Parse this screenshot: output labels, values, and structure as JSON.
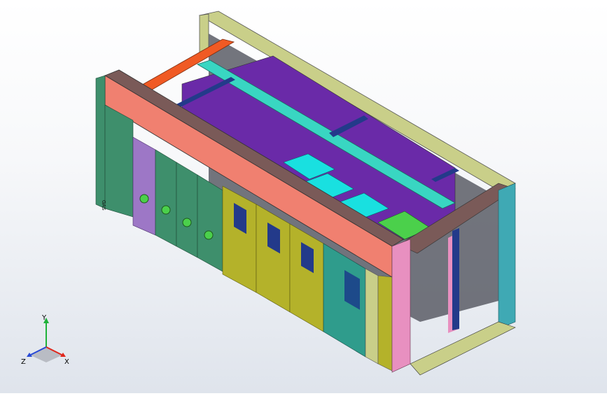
{
  "viewport": {
    "background_top": "#ffffff",
    "background_bottom": "#dfe4ec"
  },
  "triad": {
    "x_label": "X",
    "y_label": "Y",
    "z_label": "Z",
    "x_color": "#e0261b",
    "y_color": "#1fb23a",
    "z_color": "#2749d6"
  },
  "model": {
    "vent_label": "GAS",
    "colors": {
      "top_rail_back": "#c9cf89",
      "top_rail_front": "#f08070",
      "front_cap": "#7a5a58",
      "cyan_rail": "#39d6c2",
      "orange_bar": "#f05a24",
      "purple_panel": "#6a2aa8",
      "cyan_plate": "#19e0e0",
      "green_plate": "#4bd04b",
      "module_green": "#3e8f6c",
      "module_purple": "#9d77c6",
      "module_yellow": "#b4b22a",
      "module_teal": "#2f9c8c",
      "side_pink": "#e890c0",
      "frame_teal": "#3fa9b4",
      "dark_bar": "#233a8a"
    }
  }
}
